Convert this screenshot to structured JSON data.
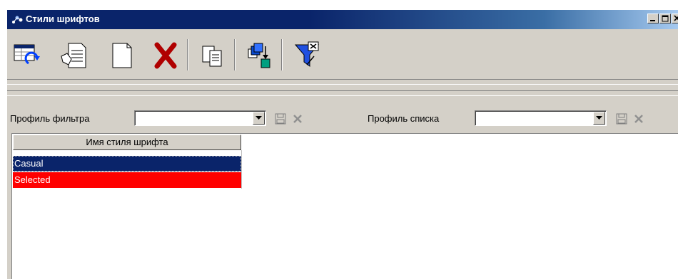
{
  "window": {
    "title": "Стили шрифтов",
    "icons": [
      "app-icon",
      "minimize-icon",
      "maximize-icon",
      "close-icon"
    ]
  },
  "toolbar": {
    "buttons": [
      {
        "name": "refresh-button",
        "icon": "refresh-icon"
      },
      {
        "name": "edit-button",
        "icon": "edit-document-icon"
      },
      {
        "name": "new-button",
        "icon": "new-document-icon"
      },
      {
        "name": "delete-button",
        "icon": "delete-icon"
      },
      {
        "name": "copy-button",
        "icon": "copy-icon"
      },
      {
        "name": "export-button",
        "icon": "export-icon"
      },
      {
        "name": "filter-button",
        "icon": "filter-icon"
      }
    ]
  },
  "filters": {
    "filter_profile_label": "Профиль фильтра",
    "filter_profile_value": "",
    "list_profile_label": "Профиль списка",
    "list_profile_value": ""
  },
  "grid": {
    "column_header": "Имя стиля шрифта",
    "rows": [
      {
        "text": "Casual",
        "bg": "#0a246a",
        "state": "selected"
      },
      {
        "text": "Selected",
        "bg": "#ff0000"
      }
    ]
  },
  "colors": {
    "titlebar": "#0a246a",
    "face": "#d4d0c8",
    "selection": "#0a246a",
    "row_highlight": "#ff0000"
  }
}
